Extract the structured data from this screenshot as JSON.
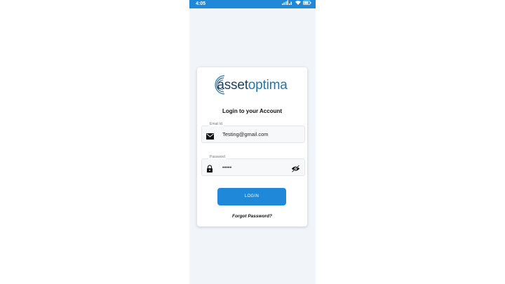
{
  "status_bar": {
    "time": "4:05",
    "signal_icon": "signal-icon",
    "wifi_icon": "wifi-icon",
    "battery_icon": "battery-icon",
    "color": "#1f88d8"
  },
  "logo": {
    "part1": "asset",
    "part2": "optima",
    "colors": {
      "dark": "#1c3f5e",
      "light": "#2775a8"
    }
  },
  "login": {
    "title": "Login to your Account",
    "email": {
      "label": "Email Id",
      "value": "Testing@gmail.com",
      "icon": "mail-icon"
    },
    "password": {
      "label": "Password",
      "value": "•••••",
      "icon": "lock-icon",
      "toggle_icon": "eye-off-icon"
    },
    "button_label": "LOGIN",
    "forgot_label": "Forgot Password?",
    "accent": "#1f88d8"
  }
}
